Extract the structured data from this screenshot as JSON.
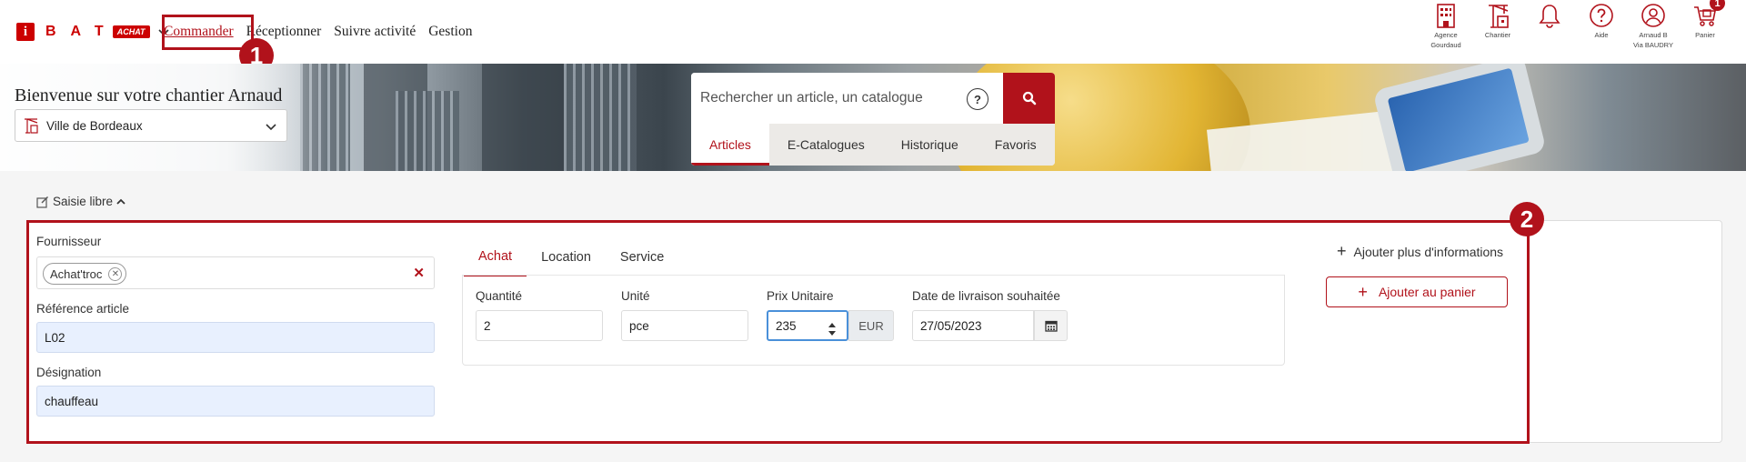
{
  "brand": {
    "letters": "BAT",
    "logo_letter": "i",
    "badge": "ACHAT",
    "accent": "#b1121b"
  },
  "nav": {
    "items": [
      {
        "label": "Commander",
        "active": true
      },
      {
        "label": "Réceptionner"
      },
      {
        "label": "Suivre activité"
      },
      {
        "label": "Gestion"
      }
    ]
  },
  "header_icons": {
    "agence": {
      "label": "Agence",
      "sublabel": "Gourdaud"
    },
    "chantier": {
      "label": "Chantier"
    },
    "notifications": {
      "icon": "bell-icon"
    },
    "aide": {
      "label": "Aide"
    },
    "user": {
      "label": "Arnaud B",
      "sublabel": "Via BAUDRY"
    },
    "panier": {
      "label": "Panier",
      "count": "1"
    }
  },
  "callouts": {
    "first": "1",
    "second": "2"
  },
  "banner": {
    "welcome": "Bienvenue sur votre chantier Arnaud",
    "site": "Ville de Bordeaux"
  },
  "search": {
    "placeholder": "Rechercher un article, un catalogue",
    "help": "?",
    "tabs": [
      {
        "label": "Articles",
        "active": true
      },
      {
        "label": "E-Catalogues"
      },
      {
        "label": "Historique"
      },
      {
        "label": "Favoris"
      }
    ]
  },
  "form": {
    "toggle_label": "Saisie libre",
    "fournisseur_label": "Fournisseur",
    "fournisseur_value": "Achat'troc",
    "reference_label": "Référence article",
    "reference_value": "L02",
    "designation_label": "Désignation",
    "designation_value": "chauffeau",
    "tabs": [
      {
        "label": "Achat",
        "active": true
      },
      {
        "label": "Location"
      },
      {
        "label": "Service"
      }
    ],
    "quantite_label": "Quantité",
    "quantite_value": "2",
    "unite_label": "Unité",
    "unite_value": "pce",
    "prix_label": "Prix Unitaire",
    "prix_value": "235",
    "currency": "EUR",
    "date_label": "Date de livraison souhaitée",
    "date_value": "27/05/2023",
    "more_info": "Ajouter plus d'informations",
    "add_to_cart": "Ajouter au panier"
  }
}
